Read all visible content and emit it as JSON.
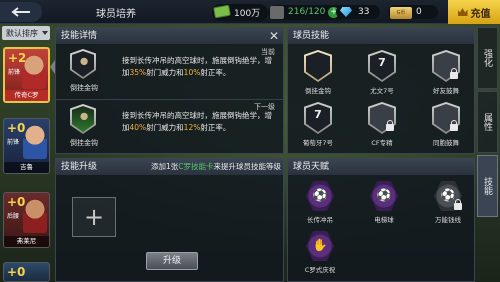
{
  "topbar": {
    "title": "球员培养",
    "money": "100万",
    "players": "216/120",
    "gems": "33",
    "coins": "0",
    "coin_label": "G币",
    "topup_label": "充值"
  },
  "sort": {
    "label": "默认排序"
  },
  "cards": [
    {
      "level": "+2",
      "position": "前锋",
      "name": "传奇C罗",
      "selected": true
    },
    {
      "level": "+0",
      "position": "前锋",
      "name": "吉鲁"
    },
    {
      "level": "+0",
      "position": "后腰",
      "name": "弗莱尼"
    },
    {
      "level": "+0",
      "position": "",
      "name": ""
    }
  ],
  "skill_detail": {
    "title": "技能详情",
    "current_tag": "当前",
    "next_tag": "下一级",
    "current": {
      "name": "倒挂金钩",
      "desc_pre": "接到长传冲吊的高空球时，施展倒钩绝学，增加",
      "p1": "35%",
      "mid": "射门威力和",
      "p2": "10%",
      "post": "射正率。"
    },
    "next": {
      "name": "倒挂金钩",
      "desc_pre": "接到长传冲吊的高空球时，施展倒钩绝学，增加",
      "p1": "40%",
      "mid": "射门威力和",
      "p2": "12%",
      "post": "射正率。"
    }
  },
  "upgrade": {
    "title": "技能升级",
    "hint_pre": "添加1张",
    "hint_hl": "C罗技能卡",
    "hint_post": "来提升球员技能等级",
    "button": "升级"
  },
  "player_skills": {
    "title": "球员技能",
    "items": [
      {
        "name": "倒挂金钩",
        "glyph": "",
        "locked": false,
        "selected": true
      },
      {
        "name": "尤文7号",
        "glyph": "7",
        "locked": false
      },
      {
        "name": "好友鼓舞",
        "glyph": "",
        "locked": true
      },
      {
        "name": "葡萄牙7号",
        "glyph": "7",
        "locked": false
      },
      {
        "name": "CF专精",
        "glyph": "",
        "locked": true
      },
      {
        "name": "同胞鼓舞",
        "glyph": "",
        "locked": true
      }
    ]
  },
  "talents": {
    "title": "球员天赋",
    "items": [
      {
        "name": "长传冲吊",
        "glyph": "⚽",
        "locked": false
      },
      {
        "name": "电梯球",
        "glyph": "⚽",
        "locked": false
      },
      {
        "name": "万能钱线",
        "glyph": "⚽",
        "locked": true
      },
      {
        "name": "C罗式庆祝",
        "glyph": "✋",
        "locked": false
      }
    ]
  },
  "side_tabs": [
    "强化",
    "属性",
    "技能"
  ]
}
